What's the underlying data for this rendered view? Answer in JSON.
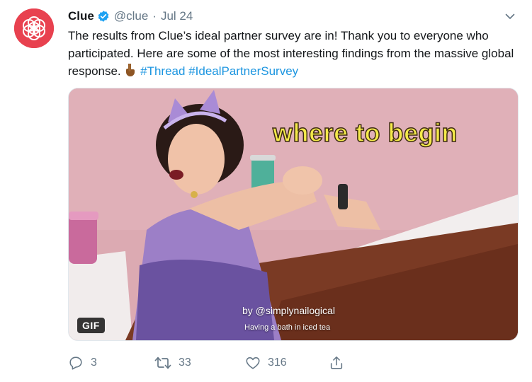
{
  "tweet": {
    "author_name": "Clue",
    "handle": "@clue",
    "separator": "·",
    "date": "Jul 24",
    "text_main": "The results from Clue’s ideal partner survey are in! Thank you to everyone who participated. Here are some of the most interesting findings from the massive global response. ",
    "hashtags": [
      "#Thread",
      "#IdealPartnerSurvey"
    ],
    "emoji": "pointing-down-emoji"
  },
  "media": {
    "overlay_text": "where to begin",
    "credit": "by @simplynailogical",
    "caption": "Having a bath in iced tea",
    "badge": "GIF"
  },
  "actions": {
    "reply_count": "3",
    "retweet_count": "33",
    "like_count": "316"
  },
  "colors": {
    "brand_red": "#e8414f",
    "link_blue": "#1b95e0",
    "verified_blue": "#1da1f2",
    "muted_gray": "#657786",
    "overlay_yellow": "#f4ea4a"
  },
  "icons": [
    "clue-logo-icon",
    "verified-badge-icon",
    "chevron-down-icon",
    "reply-icon",
    "retweet-icon",
    "like-icon",
    "share-icon"
  ]
}
